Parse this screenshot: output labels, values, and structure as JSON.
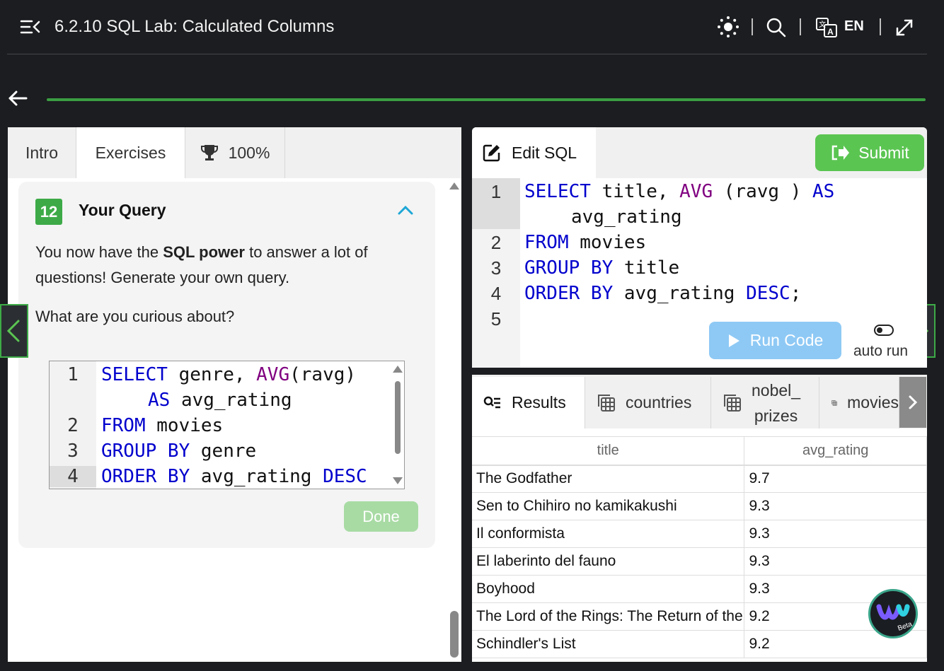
{
  "topbar": {
    "title": "6.2.10 SQL Lab: Calculated Columns",
    "language": "EN"
  },
  "left_tabs": {
    "intro": "Intro",
    "exercises": "Exercises",
    "score": "100%"
  },
  "card": {
    "number": "12",
    "title": "Your Query",
    "p1_pre": "You now have the ",
    "p1_bold": "SQL power",
    "p1_post": " to answer a lot of questions! Generate your own query.",
    "p2": "What are you curious about?",
    "done_label": "Done"
  },
  "mini_editor": {
    "line_numbers": [
      "1",
      "2",
      "3",
      "4"
    ],
    "l1_kw1": "SELECT",
    "l1_text": " genre, ",
    "l1_fn": "AVG",
    "l1_rest": "(ravg)",
    "l1b_kw": "AS",
    "l1b_text": " avg_rating",
    "l2_kw": "FROM",
    "l2_text": " movies",
    "l3_kw": "GROUP BY",
    "l3_text": " genre",
    "l4_kw": "ORDER BY",
    "l4_text": " avg_rating ",
    "l4_kw2": "DESC"
  },
  "editor": {
    "tab_label": "Edit SQL",
    "submit_label": "Submit",
    "line_numbers": [
      "1",
      "2",
      "3",
      "4",
      "5"
    ],
    "l1_kw1": "SELECT",
    "l1_text": " title, ",
    "l1_fn": "AVG",
    "l1_rest": " (ravg ) ",
    "l1_kw2": "AS",
    "l1b_text": "avg_rating",
    "l2_kw": "FROM",
    "l2_text": " movies",
    "l3_kw": "GROUP BY",
    "l3_text": " title",
    "l4_kw": "ORDER BY",
    "l4_text": " avg_rating ",
    "l4_kw2": "DESC",
    "l4_end": ";",
    "run_label": "Run Code",
    "autorun_label": "auto run"
  },
  "results": {
    "tabs": [
      "Results",
      "countries",
      "nobel_\nprizes",
      "movies"
    ],
    "tab_nobel_1": "nobel_",
    "tab_nobel_2": "prizes",
    "columns": [
      "title",
      "avg_rating"
    ],
    "rows": [
      [
        "The Godfather",
        "9.7"
      ],
      [
        "Sen to Chihiro no kamikakushi",
        "9.3"
      ],
      [
        "Il conformista",
        "9.3"
      ],
      [
        "El laberinto del fauno",
        "9.3"
      ],
      [
        "Boyhood",
        "9.3"
      ],
      [
        "The Lord of the Rings: The Return of the King",
        "9.2"
      ],
      [
        "Schindler's List",
        "9.2"
      ]
    ]
  },
  "beta_label": "Beta",
  "colors": {
    "accent_green": "#3daa47",
    "submit_green": "#5bc552",
    "keyword_blue": "#0000cd",
    "function_purple": "#800080",
    "run_blue": "#8ec9f5"
  }
}
